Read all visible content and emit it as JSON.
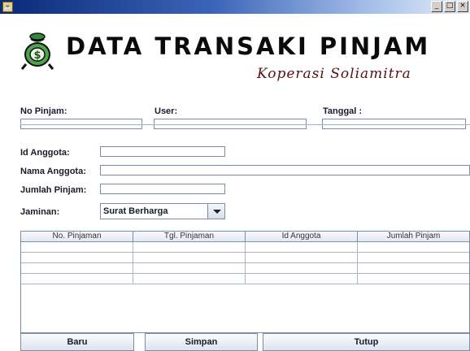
{
  "window": {
    "controls": [
      "_",
      "□",
      "×"
    ]
  },
  "header": {
    "title": "DATA TRANSAKI PINJAM",
    "subtitle": "Koperasi Soliamitra"
  },
  "top_fields": {
    "no_pinjam": {
      "label": "No Pinjam:",
      "value": ""
    },
    "user": {
      "label": "User:",
      "value": ""
    },
    "tanggal": {
      "label": "Tanggal :",
      "value": ""
    }
  },
  "form": {
    "id_anggota": {
      "label": "Id Anggota:",
      "value": ""
    },
    "nama_anggota": {
      "label": "Nama Anggota:",
      "value": ""
    },
    "jumlah_pinjam": {
      "label": "Jumlah Pinjam:",
      "value": ""
    },
    "jaminan": {
      "label": "Jaminan:",
      "selected": "Surat Berharga"
    }
  },
  "table": {
    "columns": [
      "No. Pinjaman",
      "Tgl. Pinjaman",
      "Id Anggota",
      "Jumlah Pinjam"
    ],
    "rows": [
      [
        "",
        "",
        "",
        ""
      ],
      [
        "",
        "",
        "",
        ""
      ],
      [
        "",
        "",
        "",
        ""
      ],
      [
        "",
        "",
        "",
        ""
      ]
    ]
  },
  "buttons": {
    "baru": "Baru",
    "simpan": "Simpan",
    "tutup": "Tutup"
  },
  "colors": {
    "title_bar": "#0a2a78",
    "subtitle": "#5a0f0f",
    "field_border": "#7a8ea8"
  }
}
